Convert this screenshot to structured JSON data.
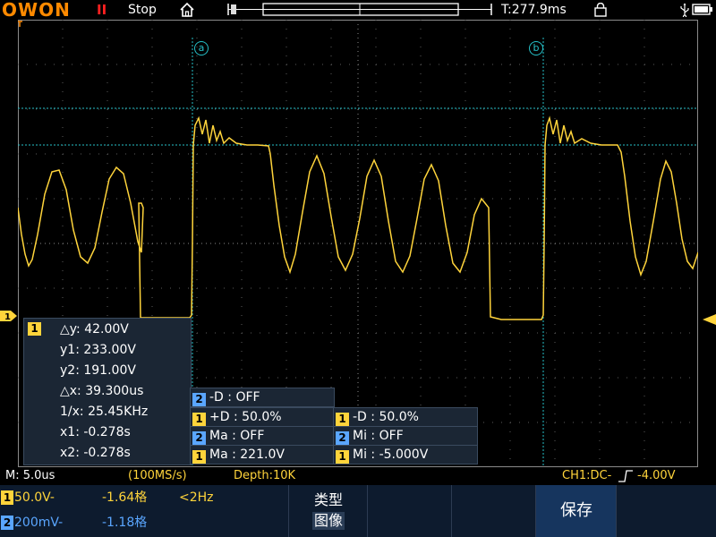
{
  "header": {
    "logo": "OWON",
    "run_indicator": "II",
    "run_state": "Stop",
    "trigger_time": "T:277.9ms"
  },
  "cursors": {
    "a_label": "a",
    "b_label": "b"
  },
  "measurements": {
    "channel": "1",
    "dy": "△y: 42.00V",
    "y1": "y1: 233.00V",
    "y2": "y2: 191.00V",
    "dx": "△x: 39.300us",
    "inv_dx": "1/x: 25.45KHz",
    "x1": "x1: -0.278s",
    "x2": "x2: -0.278s"
  },
  "options": [
    {
      "ch": "2",
      "text": "-D : OFF"
    },
    {
      "ch": "1",
      "text": "+D : 50.0%"
    },
    {
      "ch": "1",
      "text": "-D : 50.0%"
    },
    {
      "ch": "2",
      "text": "Ma : OFF"
    },
    {
      "ch": "2",
      "text": "Mi : OFF"
    },
    {
      "ch": "1",
      "text": "Ma : 221.0V"
    },
    {
      "ch": "1",
      "text": "Mi : -5.000V"
    }
  ],
  "status": {
    "timebase": "M: 5.0us",
    "sample_rate": "(100MS/s)",
    "depth": "Depth:10K",
    "trigger": "CH1:DC-",
    "trigger_level": "-4.00V"
  },
  "channels": [
    {
      "num": "1",
      "scale": "50.0V-",
      "offset": "-1.64格",
      "freq": "<2Hz",
      "color": "#ffd43b"
    },
    {
      "num": "2",
      "scale": "200mV-",
      "offset": "-1.18格",
      "color": "#5aa6ff"
    }
  ],
  "softkeys": {
    "type_label": "类型",
    "type_value": "图像",
    "save": "保存"
  },
  "colors": {
    "ch1": "#ffd43b",
    "ch2": "#5aa6ff",
    "cursor": "#26c0c8",
    "grid": "#6a6a6a",
    "logo": "#ff8a00"
  }
}
